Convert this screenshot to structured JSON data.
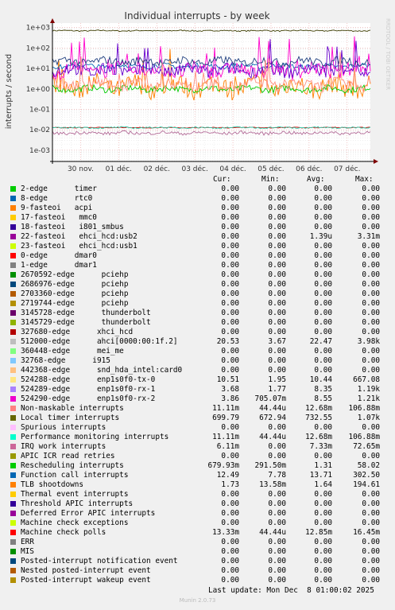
{
  "chart_data": {
    "type": "line",
    "title": "Individual interrupts - by week",
    "ylabel": "interrupts / second",
    "xlabel": "",
    "watermark": "RRDTOOL / TOBI OETIKER",
    "y_scale": "log",
    "ylim": [
      0.0003,
      1000
    ],
    "y_ticks": [
      "1e+03",
      "1e+02",
      "1e+01",
      "1e+00",
      "1e-01",
      "1e-02",
      "1e-03"
    ],
    "x_ticks": [
      "30 nov.",
      "01 déc.",
      "02 déc.",
      "03 déc.",
      "04 déc.",
      "05 déc.",
      "06 déc.",
      "07 déc."
    ],
    "grid": true,
    "series": [
      {
        "name": "Local timer interrupts",
        "color": "#3d3d00",
        "level": 700,
        "spread": 0.03
      },
      {
        "name": "Rescheduling interrupts",
        "color": "#ff7f00",
        "level": 1.3,
        "spread": 0.5
      },
      {
        "name": "2670592-edge pciehp",
        "color": "#00cc00",
        "level": 1.0,
        "spread": 0.15
      },
      {
        "name": "Function call interrupts",
        "color": "#0066b3",
        "level": 13,
        "spread": 0.12
      },
      {
        "name": "524290-edge enp1s0f0-rx-2",
        "color": "#ff00cc",
        "level": 8,
        "spread": 0.35
      },
      {
        "name": "524289-edge enp1s0f0-rx-1",
        "color": "#6600cc",
        "level": 8,
        "spread": 0.3
      },
      {
        "name": "512000-edge ahci[0000:00:1f.2]",
        "color": "#1f3f7f",
        "level": 22,
        "spread": 0.2
      },
      {
        "name": "TLB shootdowns",
        "color": "#ff8f7f",
        "level": 1.6,
        "spread": 0.3
      },
      {
        "name": "Machine check polls",
        "color": "#cc0000",
        "level": 0.0128,
        "spread": 0.02
      },
      {
        "name": "IRQ work interrupts",
        "color": "#b36a97",
        "level": 0.007,
        "spread": 0.08
      },
      {
        "name": "Performance monitoring interrupts",
        "color": "#33ccaa",
        "level": 0.0127,
        "spread": 0.04
      }
    ]
  },
  "legend": {
    "headers": [
      "Cur:",
      "Min:",
      "Avg:",
      "Max:"
    ],
    "rows": [
      {
        "name": "2-edge      timer",
        "color": "#00cc00",
        "cur": "0.00",
        "min": "0.00",
        "avg": "0.00",
        "max": "0.00"
      },
      {
        "name": "8-edge      rtc0",
        "color": "#0066b3",
        "cur": "0.00",
        "min": "0.00",
        "avg": "0.00",
        "max": "0.00"
      },
      {
        "name": "9-fasteoi   acpi",
        "color": "#ff8000",
        "cur": "0.00",
        "min": "0.00",
        "avg": "0.00",
        "max": "0.00"
      },
      {
        "name": "17-fasteoi   mmc0",
        "color": "#ffcc00",
        "cur": "0.00",
        "min": "0.00",
        "avg": "0.00",
        "max": "0.00"
      },
      {
        "name": "18-fasteoi   i801_smbus",
        "color": "#330099",
        "cur": "0.00",
        "min": "0.00",
        "avg": "0.00",
        "max": "0.00"
      },
      {
        "name": "22-fasteoi   ehci_hcd:usb2",
        "color": "#990099",
        "cur": "0.00",
        "min": "0.00",
        "avg": "1.39u",
        "max": "3.31m"
      },
      {
        "name": "23-fasteoi   ehci_hcd:usb1",
        "color": "#ccff00",
        "cur": "0.00",
        "min": "0.00",
        "avg": "0.00",
        "max": "0.00"
      },
      {
        "name": "0-edge      dmar0",
        "color": "#ff0000",
        "cur": "0.00",
        "min": "0.00",
        "avg": "0.00",
        "max": "0.00"
      },
      {
        "name": "1-edge      dmar1",
        "color": "#808080",
        "cur": "0.00",
        "min": "0.00",
        "avg": "0.00",
        "max": "0.00"
      },
      {
        "name": "2670592-edge      pciehp",
        "color": "#008f00",
        "cur": "0.00",
        "min": "0.00",
        "avg": "0.00",
        "max": "0.00"
      },
      {
        "name": "2686976-edge      pciehp",
        "color": "#00487d",
        "cur": "0.00",
        "min": "0.00",
        "avg": "0.00",
        "max": "0.00"
      },
      {
        "name": "2703360-edge      pciehp",
        "color": "#b35a00",
        "cur": "0.00",
        "min": "0.00",
        "avg": "0.00",
        "max": "0.00"
      },
      {
        "name": "2719744-edge      pciehp",
        "color": "#b38f00",
        "cur": "0.00",
        "min": "0.00",
        "avg": "0.00",
        "max": "0.00"
      },
      {
        "name": "3145728-edge      thunderbolt",
        "color": "#6b006b",
        "cur": "0.00",
        "min": "0.00",
        "avg": "0.00",
        "max": "0.00"
      },
      {
        "name": "3145729-edge      thunderbolt",
        "color": "#8fb300",
        "cur": "0.00",
        "min": "0.00",
        "avg": "0.00",
        "max": "0.00"
      },
      {
        "name": "327680-edge      xhci_hcd",
        "color": "#b30000",
        "cur": "0.00",
        "min": "0.00",
        "avg": "0.00",
        "max": "0.00"
      },
      {
        "name": "512000-edge      ahci[0000:00:1f.2]",
        "color": "#bebebe",
        "cur": "20.53",
        "min": "3.67",
        "avg": "22.47",
        "max": "3.98k"
      },
      {
        "name": "360448-edge      mei_me",
        "color": "#80ff80",
        "cur": "0.00",
        "min": "0.00",
        "avg": "0.00",
        "max": "0.00"
      },
      {
        "name": "32768-edge      i915",
        "color": "#80c9ff",
        "cur": "0.00",
        "min": "0.00",
        "avg": "0.00",
        "max": "0.00"
      },
      {
        "name": "442368-edge      snd_hda_intel:card0",
        "color": "#ffc080",
        "cur": "0.00",
        "min": "0.00",
        "avg": "0.00",
        "max": "0.00"
      },
      {
        "name": "524288-edge      enp1s0f0-tx-0",
        "color": "#ffe680",
        "cur": "10.51",
        "min": "1.95",
        "avg": "10.44",
        "max": "667.08"
      },
      {
        "name": "524289-edge      enp1s0f0-rx-1",
        "color": "#aa80ff",
        "cur": "3.68",
        "min": "1.77",
        "avg": "8.35",
        "max": "1.19k"
      },
      {
        "name": "524290-edge      enp1s0f0-rx-2",
        "color": "#ee00cc",
        "cur": "3.86",
        "min": "705.07m",
        "avg": "8.55",
        "max": "1.21k"
      },
      {
        "name": "Non-maskable interrupts",
        "color": "#ff8080",
        "cur": "11.11m",
        "min": "44.44u",
        "avg": "12.68m",
        "max": "106.88m"
      },
      {
        "name": "Local timer interrupts",
        "color": "#666600",
        "cur": "699.79",
        "min": "672.94",
        "avg": "732.55",
        "max": "1.07k"
      },
      {
        "name": "Spurious interrupts",
        "color": "#ffbfff",
        "cur": "0.00",
        "min": "0.00",
        "avg": "0.00",
        "max": "0.00"
      },
      {
        "name": "Performance monitoring interrupts",
        "color": "#00ffcc",
        "cur": "11.11m",
        "min": "44.44u",
        "avg": "12.68m",
        "max": "106.88m"
      },
      {
        "name": "IRQ work interrupts",
        "color": "#cc6699",
        "cur": "6.11m",
        "min": "0.00",
        "avg": "7.33m",
        "max": "72.65m"
      },
      {
        "name": "APIC ICR read retries",
        "color": "#999900",
        "cur": "0.00",
        "min": "0.00",
        "avg": "0.00",
        "max": "0.00"
      },
      {
        "name": "Rescheduling interrupts",
        "color": "#00cc00",
        "cur": "679.93m",
        "min": "291.50m",
        "avg": "1.31",
        "max": "58.02"
      },
      {
        "name": "Function call interrupts",
        "color": "#0066b3",
        "cur": "12.49",
        "min": "7.78",
        "avg": "13.71",
        "max": "302.50"
      },
      {
        "name": "TLB shootdowns",
        "color": "#ff8000",
        "cur": "1.73",
        "min": "13.58m",
        "avg": "1.64",
        "max": "194.61"
      },
      {
        "name": "Thermal event interrupts",
        "color": "#ffcc00",
        "cur": "0.00",
        "min": "0.00",
        "avg": "0.00",
        "max": "0.00"
      },
      {
        "name": "Threshold APIC interrupts",
        "color": "#330099",
        "cur": "0.00",
        "min": "0.00",
        "avg": "0.00",
        "max": "0.00"
      },
      {
        "name": "Deferred Error APIC interrupts",
        "color": "#990099",
        "cur": "0.00",
        "min": "0.00",
        "avg": "0.00",
        "max": "0.00"
      },
      {
        "name": "Machine check exceptions",
        "color": "#ccff00",
        "cur": "0.00",
        "min": "0.00",
        "avg": "0.00",
        "max": "0.00"
      },
      {
        "name": "Machine check polls",
        "color": "#ff0000",
        "cur": "13.33m",
        "min": "44.44u",
        "avg": "12.85m",
        "max": "16.45m"
      },
      {
        "name": "ERR",
        "color": "#808080",
        "cur": "0.00",
        "min": "0.00",
        "avg": "0.00",
        "max": "0.00"
      },
      {
        "name": "MIS",
        "color": "#008f00",
        "cur": "0.00",
        "min": "0.00",
        "avg": "0.00",
        "max": "0.00"
      },
      {
        "name": "Posted-interrupt notification event",
        "color": "#00487d",
        "cur": "0.00",
        "min": "0.00",
        "avg": "0.00",
        "max": "0.00"
      },
      {
        "name": "Nested posted-interrupt event",
        "color": "#b35a00",
        "cur": "0.00",
        "min": "0.00",
        "avg": "0.00",
        "max": "0.00"
      },
      {
        "name": "Posted-interrupt wakeup event",
        "color": "#b38f00",
        "cur": "0.00",
        "min": "0.00",
        "avg": "0.00",
        "max": "0.00"
      }
    ]
  },
  "footer": {
    "last_update": "Last update: Mon Dec  8 01:00:02 2025",
    "generator": "Munin 2.0.73"
  }
}
